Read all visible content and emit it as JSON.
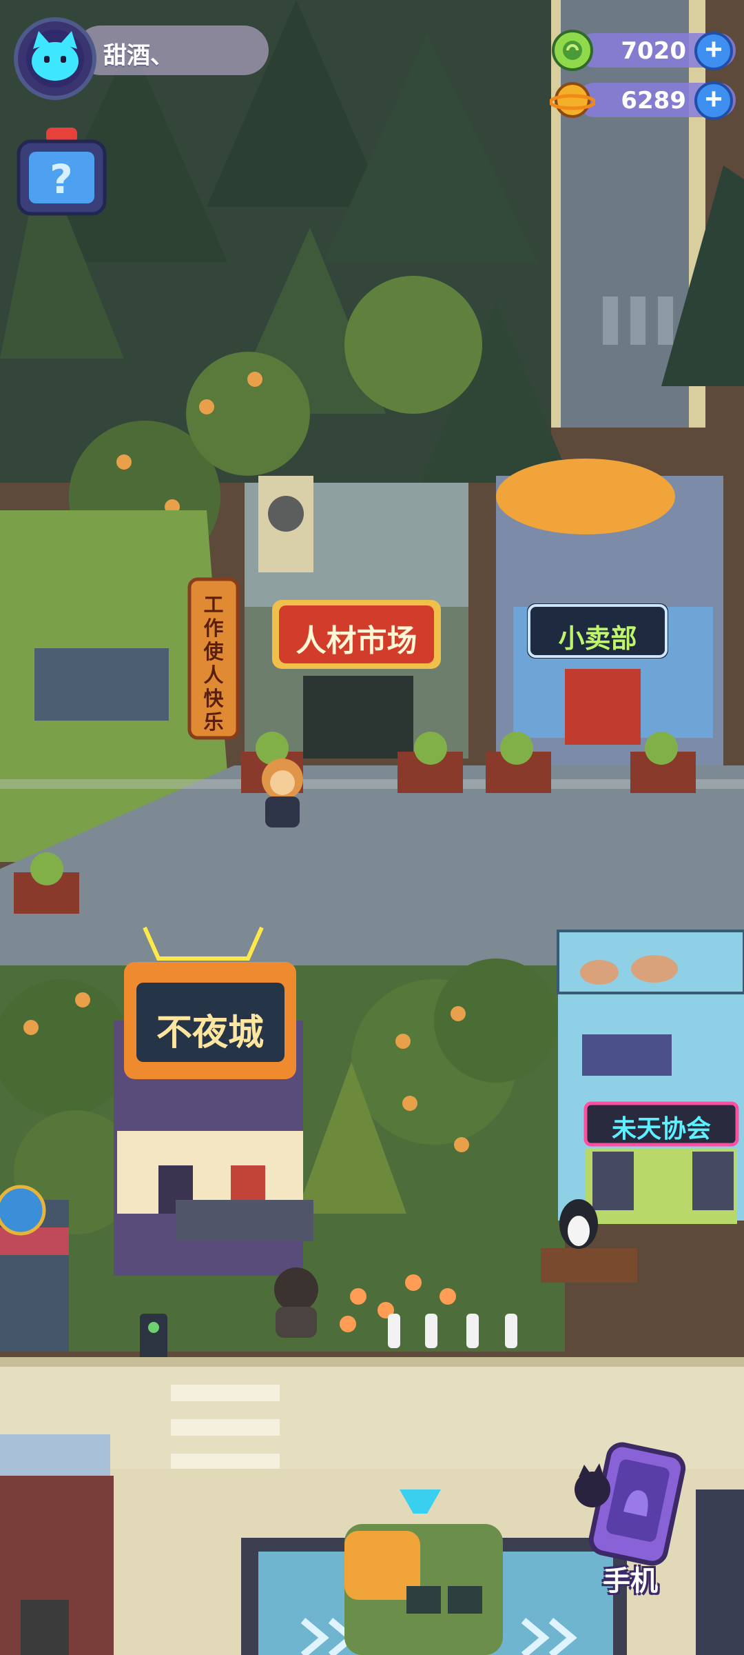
{
  "player": {
    "name": "甜酒、"
  },
  "currencies": [
    {
      "icon": "green-gem-coin-icon",
      "value": "7020"
    },
    {
      "icon": "gold-planet-coin-icon",
      "value": "6289"
    }
  ],
  "plus_symbol": "+",
  "buildings": {
    "talent_market": "人材市场",
    "shop": "小卖部",
    "banner": "工作使人快乐",
    "nightclub": "不夜城",
    "association": "未天协会"
  },
  "phone": {
    "label": "手机"
  },
  "colors": {
    "hud_bar": "#877dd8",
    "plus": "#3e8ff0",
    "road": "#7d8a93",
    "grass": "#6d8e3e"
  }
}
